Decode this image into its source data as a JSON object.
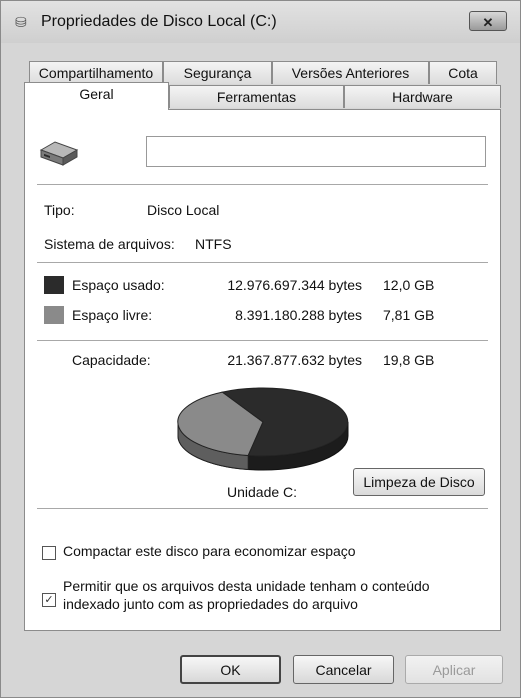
{
  "window": {
    "title": "Propriedades de Disco Local (C:)",
    "close_glyph": "✕"
  },
  "tabs": {
    "row1": [
      "Compartilhamento",
      "Segurança",
      "Versões Anteriores",
      "Cota"
    ],
    "row2": [
      "Geral",
      "Ferramentas",
      "Hardware"
    ],
    "active": "Geral"
  },
  "general": {
    "name_value": "",
    "type_label": "Tipo:",
    "type_value": "Disco Local",
    "fs_label": "Sistema de arquivos:",
    "fs_value": "NTFS",
    "used": {
      "label": "Espaço usado:",
      "bytes": "12.976.697.344 bytes",
      "size": "12,0 GB",
      "color": "#2b2b2b"
    },
    "free": {
      "label": "Espaço livre:",
      "bytes": "8.391.180.288 bytes",
      "size": "7,81 GB",
      "color": "#8a8a8a"
    },
    "capacity": {
      "label": "Capacidade:",
      "bytes": "21.367.877.632 bytes",
      "size": "19,8 GB"
    },
    "used_fraction": 0.607,
    "drive_label": "Unidade C:",
    "cleanup_button": "Limpeza de Disco",
    "compress": {
      "label": "Compactar este disco para economizar espaço",
      "checked": false
    },
    "index": {
      "line1": "Permitir que os arquivos desta unidade tenham o conteúdo",
      "line2": "indexado junto com as propriedades do arquivo",
      "checked": true
    }
  },
  "buttons": {
    "ok": "OK",
    "cancel": "Cancelar",
    "apply": "Aplicar"
  },
  "icons": {
    "title": "drive-icon",
    "drive": "hard-disk-icon",
    "check": "checkmark-icon"
  }
}
